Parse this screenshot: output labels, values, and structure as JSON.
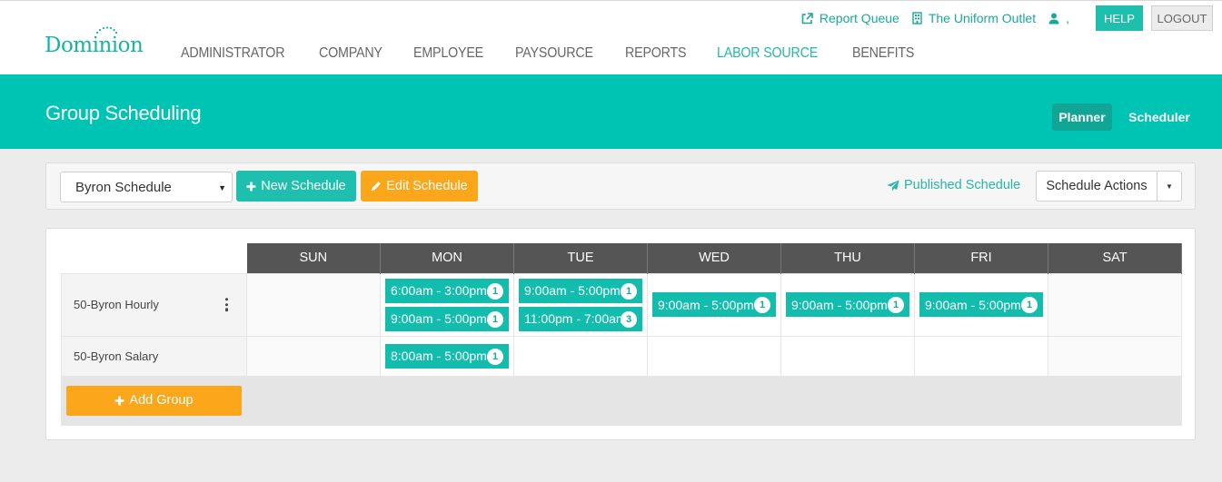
{
  "header": {
    "logo": "Dominion",
    "util_links": [
      {
        "label": "Report Queue",
        "icon": "external-link-icon"
      },
      {
        "label": "The Uniform Outlet",
        "icon": "building-icon"
      },
      {
        "label": ",",
        "icon": "user-icon"
      }
    ],
    "help_label": "HELP",
    "logout_label": "LOGOUT",
    "nav": [
      "ADMINISTRATOR",
      "COMPANY",
      "EMPLOYEE",
      "PAYSOURCE",
      "REPORTS",
      "LABOR SOURCE",
      "BENEFITS"
    ],
    "active_nav": "LABOR SOURCE"
  },
  "banner": {
    "title": "Group Scheduling",
    "tabs": [
      "Planner",
      "Scheduler"
    ],
    "active_tab": "Planner"
  },
  "toolbar": {
    "schedule_select": "Byron Schedule",
    "new_schedule_label": "New Schedule",
    "edit_schedule_label": "Edit Schedule",
    "published_label": "Published Schedule",
    "actions_label": "Schedule Actions"
  },
  "grid": {
    "days": [
      "SUN",
      "MON",
      "TUE",
      "WED",
      "THU",
      "FRI",
      "SAT"
    ],
    "rows": [
      {
        "label": "50-Byron Hourly",
        "cells": [
          [],
          [
            {
              "time": "6:00am - 3:00pm",
              "count": "1"
            },
            {
              "time": "9:00am - 5:00pm",
              "count": "1"
            }
          ],
          [
            {
              "time": "9:00am - 5:00pm",
              "count": "1"
            },
            {
              "time": "11:00pm - 7:00am",
              "count": "3"
            }
          ],
          [
            {
              "time": "9:00am - 5:00pm",
              "count": "1"
            }
          ],
          [
            {
              "time": "9:00am - 5:00pm",
              "count": "1"
            }
          ],
          [
            {
              "time": "9:00am - 5:00pm",
              "count": "1"
            }
          ],
          []
        ]
      },
      {
        "label": "50-Byron Salary",
        "cells": [
          [],
          [
            {
              "time": "8:00am - 5:00pm",
              "count": "1"
            }
          ],
          [],
          [],
          [],
          [],
          []
        ]
      }
    ],
    "add_group_label": "Add Group"
  },
  "colors": {
    "teal": "#00c4b3",
    "teal_dark": "#10a594",
    "orange": "#fca71b",
    "header_dark": "#555555"
  }
}
